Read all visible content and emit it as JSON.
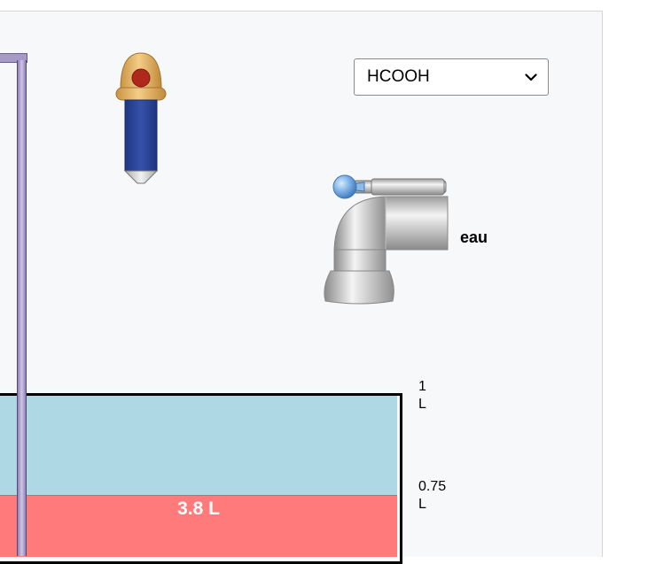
{
  "solute_selector": {
    "selected": "HCOOH",
    "icon": "chevron-down-icon"
  },
  "faucet": {
    "label": "eau",
    "icon": "water-faucet-icon"
  },
  "dropper": {
    "icon": "dropper-icon"
  },
  "beaker": {
    "ticks": [
      {
        "value": "1",
        "unit": "L"
      },
      {
        "value": "0.75",
        "unit": "L"
      }
    ],
    "solution_volume_label": "3.8 L"
  },
  "colors": {
    "water": "#add8e4",
    "solution": "#ff7b7b",
    "dropper_body": "#2e4a9e",
    "dropper_bulb": "#e4b56a",
    "probe": "#a89ac6",
    "faucet_knob": "#6fa8dc"
  }
}
